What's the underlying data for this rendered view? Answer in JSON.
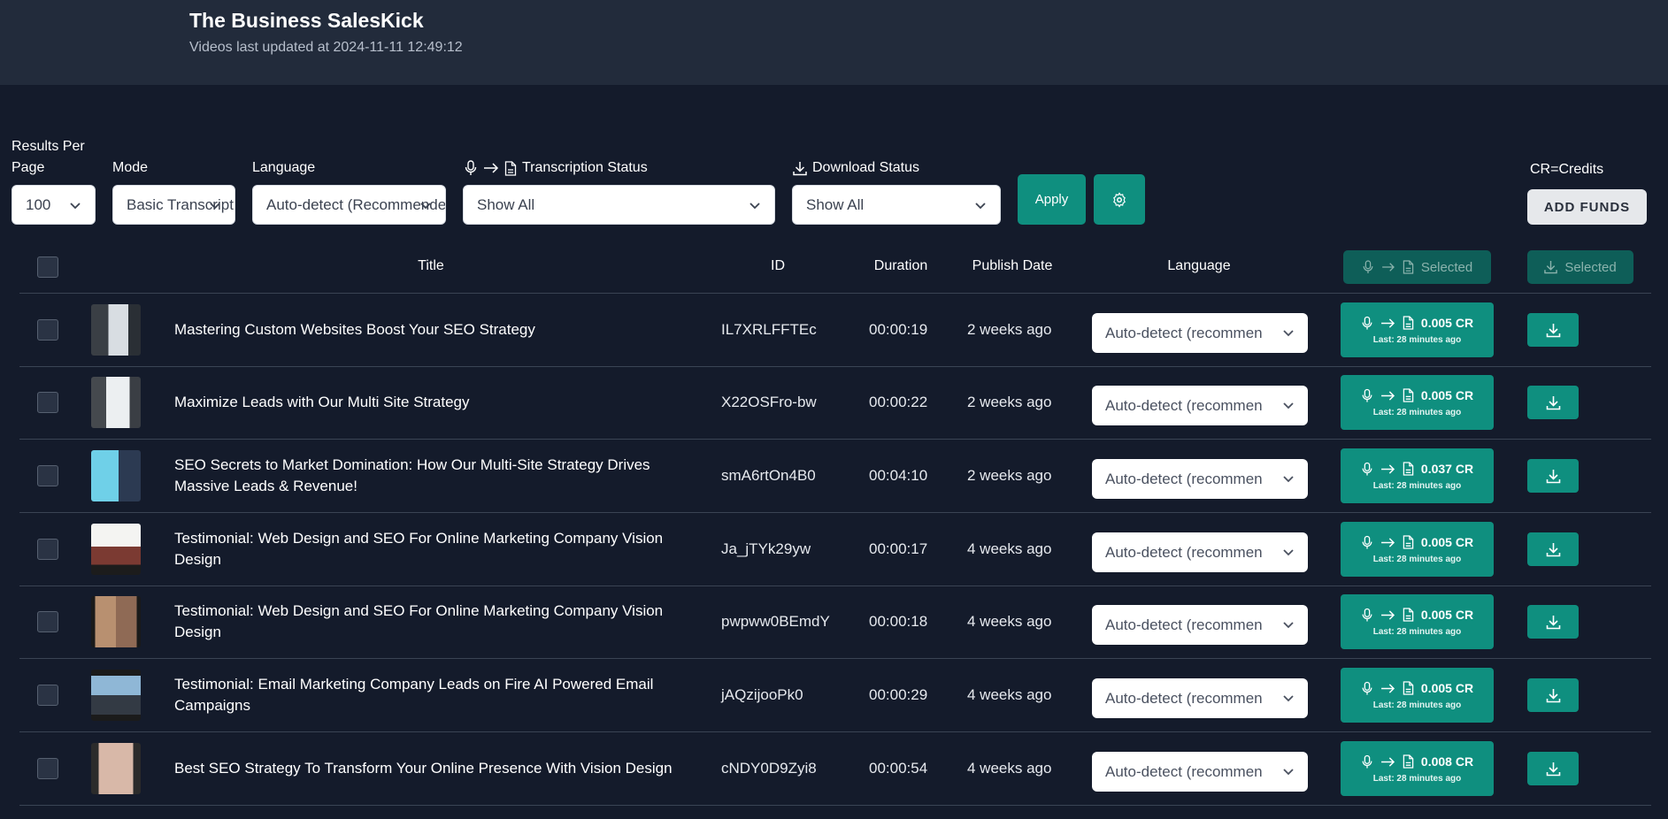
{
  "header": {
    "title": "The Business SalesKick",
    "subtitle": "Videos last updated at 2024-11-11 12:49:12"
  },
  "filters": {
    "results_per_page_label_1": "Results Per",
    "results_per_page_label_2": "Page",
    "results_per_page_value": "100",
    "mode_label": "Mode",
    "mode_value": "Basic Transcription",
    "language_label": "Language",
    "language_value": "Auto-detect (Recommended)",
    "transcription_status_label": "Transcription Status",
    "transcription_status_value": "Show All",
    "download_status_label": "Download Status",
    "download_status_value": "Show All",
    "apply_label": "Apply",
    "credits_note": "CR=Credits",
    "add_funds_label": "ADD FUNDS"
  },
  "table": {
    "headers": {
      "title": "Title",
      "id": "ID",
      "duration": "Duration",
      "publish_date": "Publish Date",
      "language": "Language",
      "transcribe_selected": "Selected",
      "download_selected": "Selected"
    },
    "rows": [
      {
        "title": "Mastering Custom Websites Boost Your SEO Strategy",
        "id": "IL7XRLFFTEc",
        "duration": "00:00:19",
        "date": "2 weeks ago",
        "language": "Auto-detect (recommended)",
        "cost": "0.005 CR",
        "last": "Last: 28 minutes ago"
      },
      {
        "title": "Maximize Leads with Our Multi Site Strategy",
        "id": "X22OSFro-bw",
        "duration": "00:00:22",
        "date": "2 weeks ago",
        "language": "Auto-detect (recommended)",
        "cost": "0.005 CR",
        "last": "Last: 28 minutes ago"
      },
      {
        "title": "SEO Secrets to Market Domination: How Our Multi-Site Strategy Drives Massive Leads & Revenue!",
        "id": "smA6rtOn4B0",
        "duration": "00:04:10",
        "date": "2 weeks ago",
        "language": "Auto-detect (recommended)",
        "cost": "0.037 CR",
        "last": "Last: 28 minutes ago"
      },
      {
        "title": "Testimonial: Web Design and SEO For Online Marketing Company Vision Design",
        "id": "Ja_jTYk29yw",
        "duration": "00:00:17",
        "date": "4 weeks ago",
        "language": "Auto-detect (recommended)",
        "cost": "0.005 CR",
        "last": "Last: 28 minutes ago"
      },
      {
        "title": "Testimonial: Web Design and SEO For Online Marketing Company Vision Design",
        "id": "pwpww0BEmdY",
        "duration": "00:00:18",
        "date": "4 weeks ago",
        "language": "Auto-detect (recommended)",
        "cost": "0.005 CR",
        "last": "Last: 28 minutes ago"
      },
      {
        "title": "Testimonial: Email Marketing Company Leads on Fire AI Powered Email Campaigns",
        "id": "jAQzijooPk0",
        "duration": "00:00:29",
        "date": "4 weeks ago",
        "language": "Auto-detect (recommended)",
        "cost": "0.005 CR",
        "last": "Last: 28 minutes ago"
      },
      {
        "title": "Best SEO Strategy To Transform Your Online Presence With Vision Design",
        "id": "cNDY0D9Zyi8",
        "duration": "00:00:54",
        "date": "4 weeks ago",
        "language": "Auto-detect (recommended)",
        "cost": "0.008 CR",
        "last": "Last: 28 minutes ago"
      }
    ]
  },
  "icons": {
    "chevron": "chevron-down-icon",
    "mic": "microphone-icon",
    "arrow": "arrow-right-icon",
    "doc": "document-icon",
    "download": "download-icon",
    "gear": "gear-icon"
  },
  "colors": {
    "background": "#141b2b",
    "header": "#222b3b",
    "accent": "#0f8f7f",
    "accent_disabled": "#0e5e58"
  }
}
